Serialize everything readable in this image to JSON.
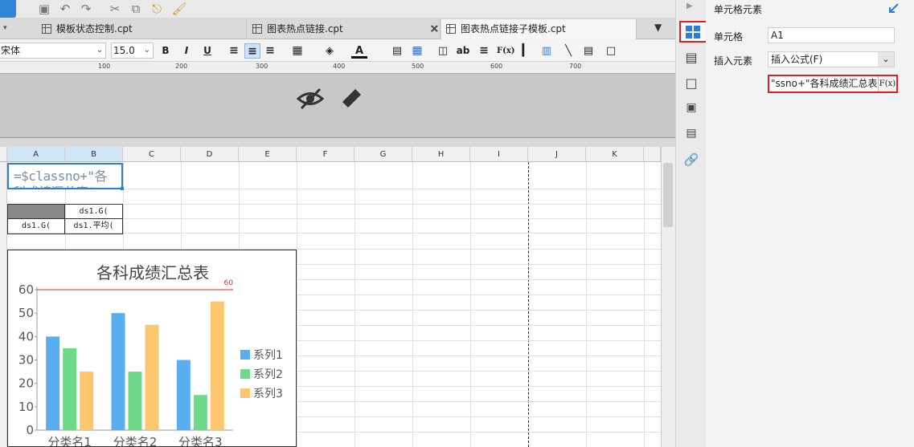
{
  "tabs": [
    {
      "label": "模板状态控制.cpt",
      "active": false
    },
    {
      "label": "图表热点链接.cpt",
      "active": false
    },
    {
      "label": "图表热点链接子模板.cpt",
      "active": true
    }
  ],
  "format_toolbar": {
    "font_name": "宋体",
    "font_size": "15.0",
    "bold": "B",
    "italic": "I",
    "underline": "U",
    "insert_text": "ab",
    "insert_formula": "F(x)"
  },
  "ruler": {
    "marks": [
      "100",
      "200",
      "300",
      "400",
      "500",
      "600",
      "700"
    ]
  },
  "columns": [
    "A",
    "B",
    "C",
    "D",
    "E",
    "F",
    "G",
    "H",
    "I",
    "J",
    "K"
  ],
  "cells": {
    "a1_formula": "=$classno+\"各",
    "a1_overflow": "科成绩汇总表\"",
    "b3": "ds1.G(",
    "a4": "ds1.G(",
    "b4": "ds1.平均("
  },
  "chart_data": {
    "type": "bar",
    "title": "各科成绩汇总表",
    "categories": [
      "分类名1",
      "分类名2",
      "分类名3"
    ],
    "series": [
      {
        "name": "系列1",
        "values": [
          40,
          50,
          30
        ],
        "color": "#5aaef0"
      },
      {
        "name": "系列2",
        "values": [
          35,
          25,
          15
        ],
        "color": "#6fd98a"
      },
      {
        "name": "系列3",
        "values": [
          25,
          45,
          55
        ],
        "color": "#fcc66e"
      }
    ],
    "ylim": [
      0,
      60
    ],
    "yticks": [
      "0",
      "10",
      "20",
      "30",
      "40",
      "50",
      "60"
    ],
    "reference_line": {
      "value": 60,
      "label": "60",
      "color": "#d9302c"
    },
    "legend": "right",
    "grid": false
  },
  "panel": {
    "title": "单元格元素",
    "cell_label": "单元格",
    "cell_value": "A1",
    "insert_label": "插入元素",
    "insert_value": "插入公式(F)",
    "formula_value": "ssno+\"各科成绩汇总表\"",
    "formula_button": "F(x)"
  },
  "colors": {
    "accent": "#2d7de0",
    "highlight_border": "#e02020",
    "selected_header": "#cfe6f8"
  }
}
